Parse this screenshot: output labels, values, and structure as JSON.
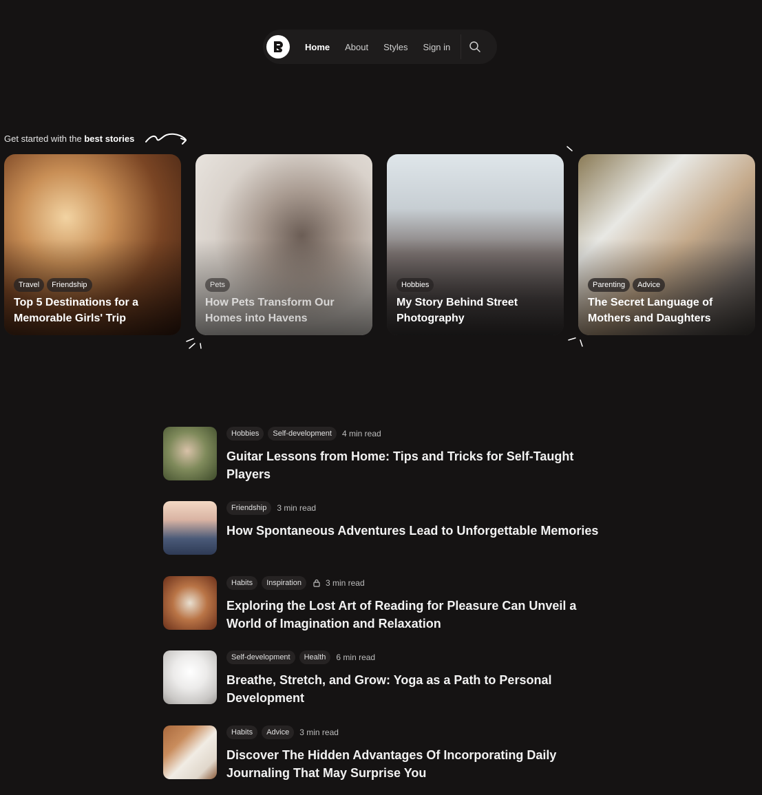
{
  "nav": {
    "logo_alt": "B",
    "links": [
      "Home",
      "About",
      "Styles",
      "Sign in"
    ],
    "active": "Home"
  },
  "heading": {
    "prefix": "Get started with the",
    "emphasis": "best stories"
  },
  "featured": [
    {
      "tags": [
        "Travel",
        "Friendship"
      ],
      "title": "Top 5 Destinations for a Memorable Girls' Trip"
    },
    {
      "tags": [
        "Pets"
      ],
      "title": "How Pets Transform Our Homes into Havens"
    },
    {
      "tags": [
        "Hobbies"
      ],
      "title": "My Story Behind Street Photography"
    },
    {
      "tags": [
        "Parenting",
        "Advice"
      ],
      "title": "The Secret Language of Mothers and Daughters"
    }
  ],
  "posts": [
    {
      "tags": [
        "Hobbies",
        "Self-development"
      ],
      "locked": false,
      "read": "4 min read",
      "title": "Guitar Lessons from Home: Tips and Tricks for Self-Taught Players"
    },
    {
      "tags": [
        "Friendship"
      ],
      "locked": false,
      "read": "3 min read",
      "title": "How Spontaneous Adventures Lead to Unforgettable Memories"
    },
    {
      "tags": [
        "Habits",
        "Inspiration"
      ],
      "locked": true,
      "read": "3 min read",
      "title": "Exploring the Lost Art of Reading for Pleasure Can Unveil a World of Imagination and Relaxation"
    },
    {
      "tags": [
        "Self-development",
        "Health"
      ],
      "locked": false,
      "read": "6 min read",
      "title": "Breathe, Stretch, and Grow: Yoga as a Path to Personal Development"
    },
    {
      "tags": [
        "Habits",
        "Advice"
      ],
      "locked": false,
      "read": "3 min read",
      "title": "Discover The Hidden Advantages Of Incorporating Daily Journaling That May Surprise You"
    }
  ],
  "colors": {
    "background": "#151313",
    "nav_bg": "#1e1c1c",
    "pill_bg": "#262323"
  }
}
